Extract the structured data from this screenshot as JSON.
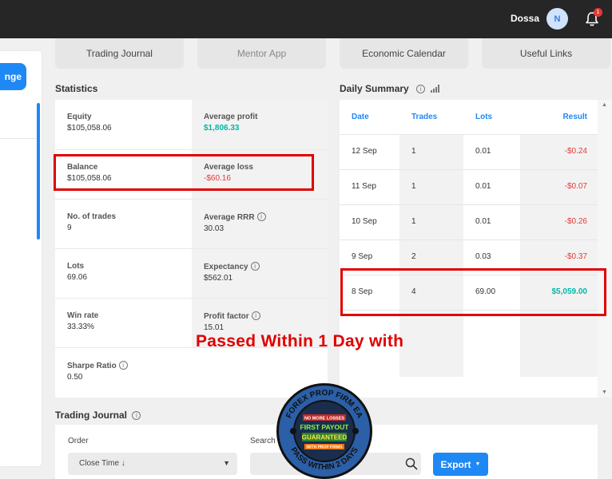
{
  "header": {
    "user_name": "Dossa",
    "avatar_initial": "N",
    "notification_count": "1"
  },
  "sidebar": {
    "button_label": "nge"
  },
  "tabs": [
    {
      "label": "Trading Journal"
    },
    {
      "label": "Mentor App"
    },
    {
      "label": "Economic Calendar"
    },
    {
      "label": "Useful Links"
    }
  ],
  "statistics": {
    "title": "Statistics",
    "items": [
      {
        "label": "Equity",
        "value": "$105,058.06"
      },
      {
        "label": "Average profit",
        "value": "$1,806.33"
      },
      {
        "label": "Balance",
        "value": "$105,058.06"
      },
      {
        "label": "Average loss",
        "value": "-$60.16"
      },
      {
        "label": "No. of trades",
        "value": "9"
      },
      {
        "label": "Average RRR",
        "value": "30.03"
      },
      {
        "label": "Lots",
        "value": "69.06"
      },
      {
        "label": "Expectancy",
        "value": "$562.01"
      },
      {
        "label": "Win rate",
        "value": "33.33%"
      },
      {
        "label": "Profit factor",
        "value": "15.01"
      },
      {
        "label": "Sharpe Ratio",
        "value": "0.50"
      }
    ]
  },
  "daily_summary": {
    "title": "Daily Summary",
    "columns": [
      "Date",
      "Trades",
      "Lots",
      "Result"
    ],
    "rows": [
      [
        "12 Sep",
        "1",
        "0.01",
        "-$0.24"
      ],
      [
        "11 Sep",
        "1",
        "0.01",
        "-$0.07"
      ],
      [
        "10 Sep",
        "1",
        "0.01",
        "-$0.26"
      ],
      [
        "9 Sep",
        "2",
        "0.03",
        "-$0.37"
      ],
      [
        "8 Sep",
        "4",
        "69.00",
        "$5,059.00"
      ]
    ]
  },
  "overlay": {
    "text": "Passed Within 1 Day with"
  },
  "logo": {
    "top_text": "FOREX PROP FIRM EA",
    "bottom_text": "PASS WITHIN 2 DAYS",
    "line1": "NO MORE LOSSES",
    "line2": "FIRST PAYOUT",
    "line3": "GUARANTEED",
    "line4": "WITH PROP FIRMS"
  },
  "trading_journal": {
    "title": "Trading Journal",
    "order_label": "Order",
    "order_value": "Close Time ↓",
    "search_label": "Search",
    "export_label": "Export"
  },
  "colors": {
    "accent": "#1e88f5",
    "positive": "#00b8a9",
    "negative": "#e53935",
    "highlight": "#e00000"
  }
}
